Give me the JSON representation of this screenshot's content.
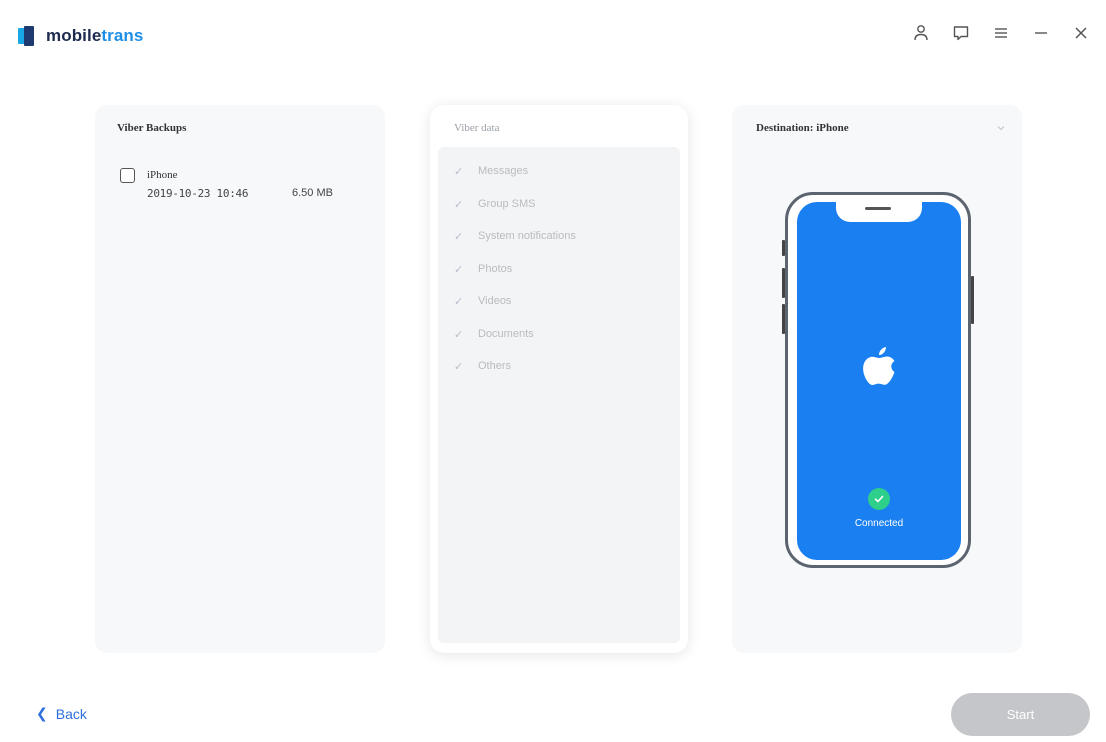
{
  "app": {
    "logo_text_part1": "mobile",
    "logo_text_part2": "trans"
  },
  "window_controls": [
    {
      "name": "account-icon"
    },
    {
      "name": "feedback-icon"
    },
    {
      "name": "menu-icon"
    },
    {
      "name": "minimize-icon"
    },
    {
      "name": "close-icon"
    }
  ],
  "left_panel": {
    "title": "Viber Backups",
    "backups": [
      {
        "device": "iPhone",
        "date": "2019-10-23 10:46",
        "size": "6.50 MB",
        "checked": false
      }
    ]
  },
  "middle_panel": {
    "title": "Viber data",
    "items": [
      {
        "label": "Messages",
        "checked": true
      },
      {
        "label": "Group SMS",
        "checked": true
      },
      {
        "label": "System notifications",
        "checked": true
      },
      {
        "label": "Photos",
        "checked": true
      },
      {
        "label": "Videos",
        "checked": true
      },
      {
        "label": "Documents",
        "checked": true
      },
      {
        "label": "Others",
        "checked": true
      }
    ]
  },
  "right_panel": {
    "title": "Destination: iPhone",
    "status": "Connected"
  },
  "footer": {
    "back_label": "Back",
    "start_label": "Start"
  },
  "colors": {
    "brand_blue": "#1f8fe6",
    "screen_blue": "#1a7ff0",
    "connected_green": "#2ecf8a",
    "start_disabled": "#c4c6c9"
  }
}
